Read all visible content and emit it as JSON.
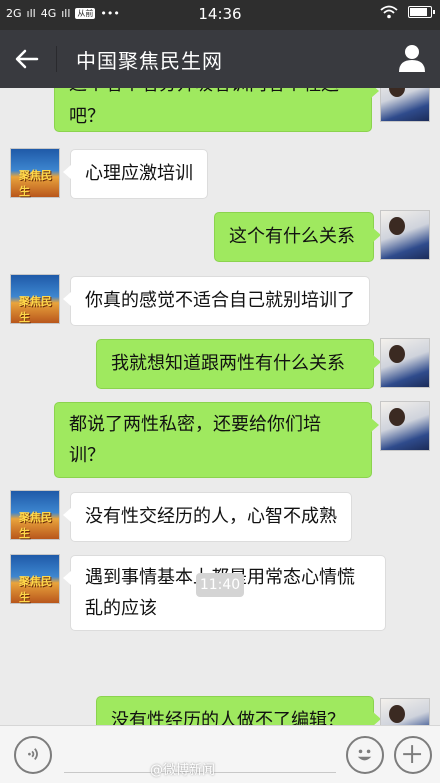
{
  "status_bar": {
    "signal_1": "2G",
    "signal_2": "4G",
    "carrier_badge": "从前",
    "more": "•••",
    "time": "14:36",
    "battery_level": 0.85
  },
  "header": {
    "title": "中国聚焦民生网"
  },
  "messages": [
    {
      "from": "user",
      "line1": "这个者个者分开吸者训内者个程运",
      "line2": "吧？"
    },
    {
      "from": "bot",
      "text": "心理应激培训"
    },
    {
      "from": "user",
      "text": "这个有什么关系"
    },
    {
      "from": "bot",
      "text": "你真的感觉不适合自己就别培训了"
    },
    {
      "from": "user",
      "text": "我就想知道跟两性有什么关系"
    },
    {
      "from": "user",
      "line1": "都说了两性私密，还要给你们培",
      "line2": "训？"
    },
    {
      "from": "bot",
      "text": "没有性交经历的人，心智不成熟"
    },
    {
      "from": "bot",
      "line1": "遇到事情基本上都是用常态心情慌",
      "line2": "乱的应该"
    },
    {
      "from": "user",
      "text": "没有性经历的人做不了编辑？"
    }
  ],
  "timestamp": "11:40",
  "avatar_label": "聚焦民生",
  "watermark": "@微博新闻",
  "colors": {
    "titlebar": "#393a3f",
    "bubble_out": "#9fe95f",
    "bubble_in": "#ffffff",
    "chat_bg": "#ebebeb"
  }
}
